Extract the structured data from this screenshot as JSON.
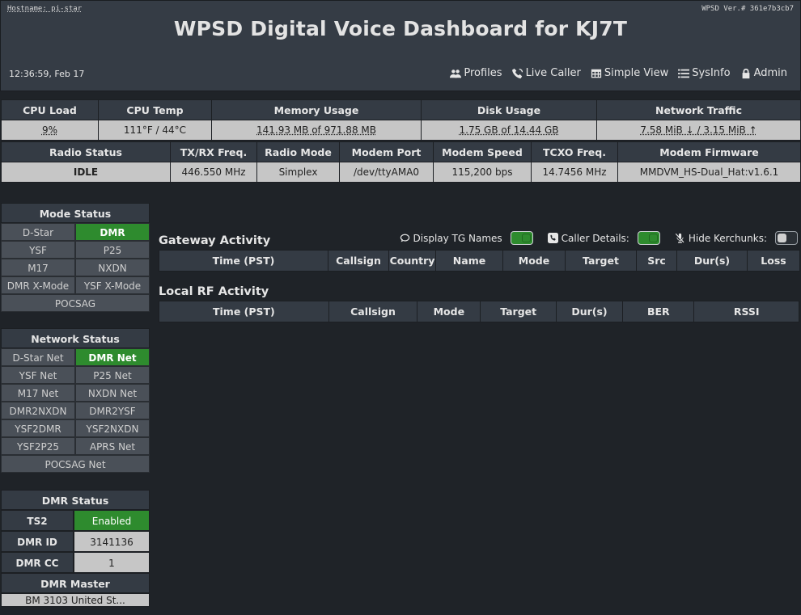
{
  "header": {
    "hostname": "Hostname: pi-star",
    "version": "WPSD Ver.# 361e7b3cb7",
    "title": "WPSD Digital Voice Dashboard for KJ7T",
    "clock": "12:36:59, Feb 17",
    "nav": [
      {
        "label": "Profiles",
        "icon": "users-icon"
      },
      {
        "label": "Live Caller",
        "icon": "phone-wave-icon"
      },
      {
        "label": "Simple View",
        "icon": "table-icon"
      },
      {
        "label": "SysInfo",
        "icon": "list-icon"
      },
      {
        "label": "Admin",
        "icon": "lock-icon"
      }
    ]
  },
  "system": {
    "headers": [
      "CPU Load",
      "CPU Temp",
      "Memory Usage",
      "Disk Usage",
      "Network Traffic"
    ],
    "values": [
      "9%",
      "111°F / 44°C",
      "141.93 MB of 971.88 MB",
      "1.75 GB of 14.44 GB",
      "7.58 MiB ↓ / 3.15 MiB ↑"
    ]
  },
  "radio": {
    "headers": [
      "Radio Status",
      "TX/RX Freq.",
      "Radio Mode",
      "Modem Port",
      "Modem Speed",
      "TCXO Freq.",
      "Modem Firmware"
    ],
    "values": [
      "IDLE",
      "446.550 MHz",
      "Simplex",
      "/dev/ttyAMA0",
      "115,200 bps",
      "14.7456 MHz",
      "MMDVM_HS-Dual_Hat:v1.6.1"
    ]
  },
  "mode_status": {
    "title": "Mode Status",
    "items": [
      "D-Star",
      "DMR",
      "YSF",
      "P25",
      "M17",
      "NXDN",
      "DMR X-Mode",
      "YSF X-Mode",
      "POCSAG"
    ]
  },
  "network_status": {
    "title": "Network Status",
    "items": [
      "D-Star Net",
      "DMR Net",
      "YSF Net",
      "P25 Net",
      "M17 Net",
      "NXDN Net",
      "DMR2NXDN",
      "DMR2YSF",
      "YSF2DMR",
      "YSF2NXDN",
      "YSF2P25",
      "APRS Net",
      "POCSAG Net"
    ]
  },
  "dmr_status": {
    "title": "DMR Status",
    "rows": [
      {
        "label": "TS2",
        "value": "Enabled"
      },
      {
        "label": "DMR ID",
        "value": "3141136"
      },
      {
        "label": "DMR CC",
        "value": "1"
      }
    ],
    "master_title": "DMR Master",
    "master_value": "BM 3103 United St..."
  },
  "gateway": {
    "title": "Gateway Activity",
    "columns": [
      "Time (PST)",
      "Callsign",
      "Country",
      "Name",
      "Mode",
      "Target",
      "Src",
      "Dur(s)",
      "Loss"
    ]
  },
  "toggles": [
    {
      "label": "Display TG Names",
      "icon": "chat-icon",
      "state": "on"
    },
    {
      "label": "Caller Details:",
      "icon": "phone-icon",
      "state": "on"
    },
    {
      "label": "Hide Kerchunks:",
      "icon": "mic-slash-icon",
      "state": "off"
    }
  ],
  "local_rf": {
    "title": "Local RF Activity",
    "columns": [
      "Time (PST)",
      "Callsign",
      "Mode",
      "Target",
      "Dur(s)",
      "BER",
      "RSSI"
    ]
  },
  "colors": {
    "background": "#1f2328",
    "panel": "#343b44",
    "active": "#2e8b2e",
    "value_cell": "#c6c6c6",
    "inactive_cell": "#4a5058"
  }
}
